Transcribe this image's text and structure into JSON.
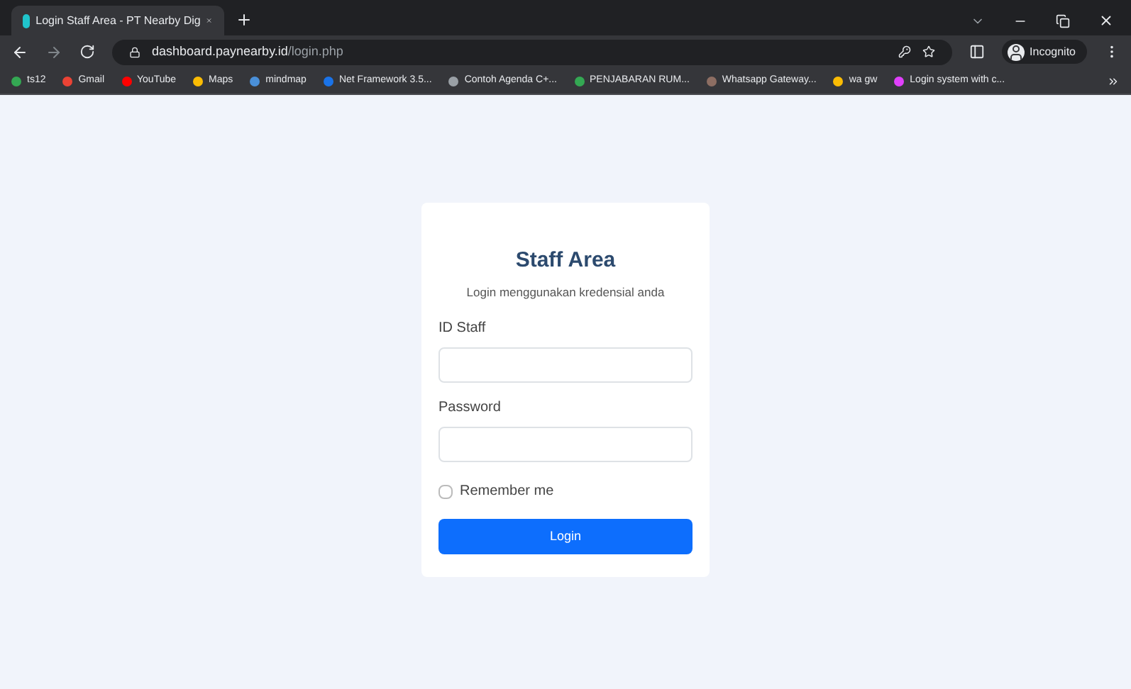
{
  "browser": {
    "tab": {
      "title": "Login Staff Area - PT Nearby Dig",
      "selected": true
    },
    "address": {
      "host": "dashboard.paynearby.id",
      "path": "/login.php"
    },
    "profile": "Incognito",
    "bookmarks": [
      {
        "label": "ts12",
        "color": "#34a853"
      },
      {
        "label": "Gmail",
        "color": "#ea4335"
      },
      {
        "label": "YouTube",
        "color": "#ff0000"
      },
      {
        "label": "Maps",
        "color": "#fbbc04"
      },
      {
        "label": "mindmap",
        "color": "#4a90d9"
      },
      {
        "label": "Net Framework 3.5...",
        "color": "#1a73e8"
      },
      {
        "label": "Contoh Agenda C+...",
        "color": "#9aa0a6"
      },
      {
        "label": "PENJABARAN RUM...",
        "color": "#34a853"
      },
      {
        "label": "Whatsapp Gateway...",
        "color": "#8d6e63"
      },
      {
        "label": "wa gw",
        "color": "#fbbc04"
      },
      {
        "label": "Login system with c...",
        "color": "#e040fb"
      }
    ]
  },
  "login": {
    "title": "Staff Area",
    "subtitle": "Login menggunakan kredensial anda",
    "fields": [
      {
        "label": "ID Staff"
      },
      {
        "label": "Password"
      }
    ],
    "remember": {
      "label": "Remember me",
      "checked": false
    },
    "button": "Login"
  }
}
